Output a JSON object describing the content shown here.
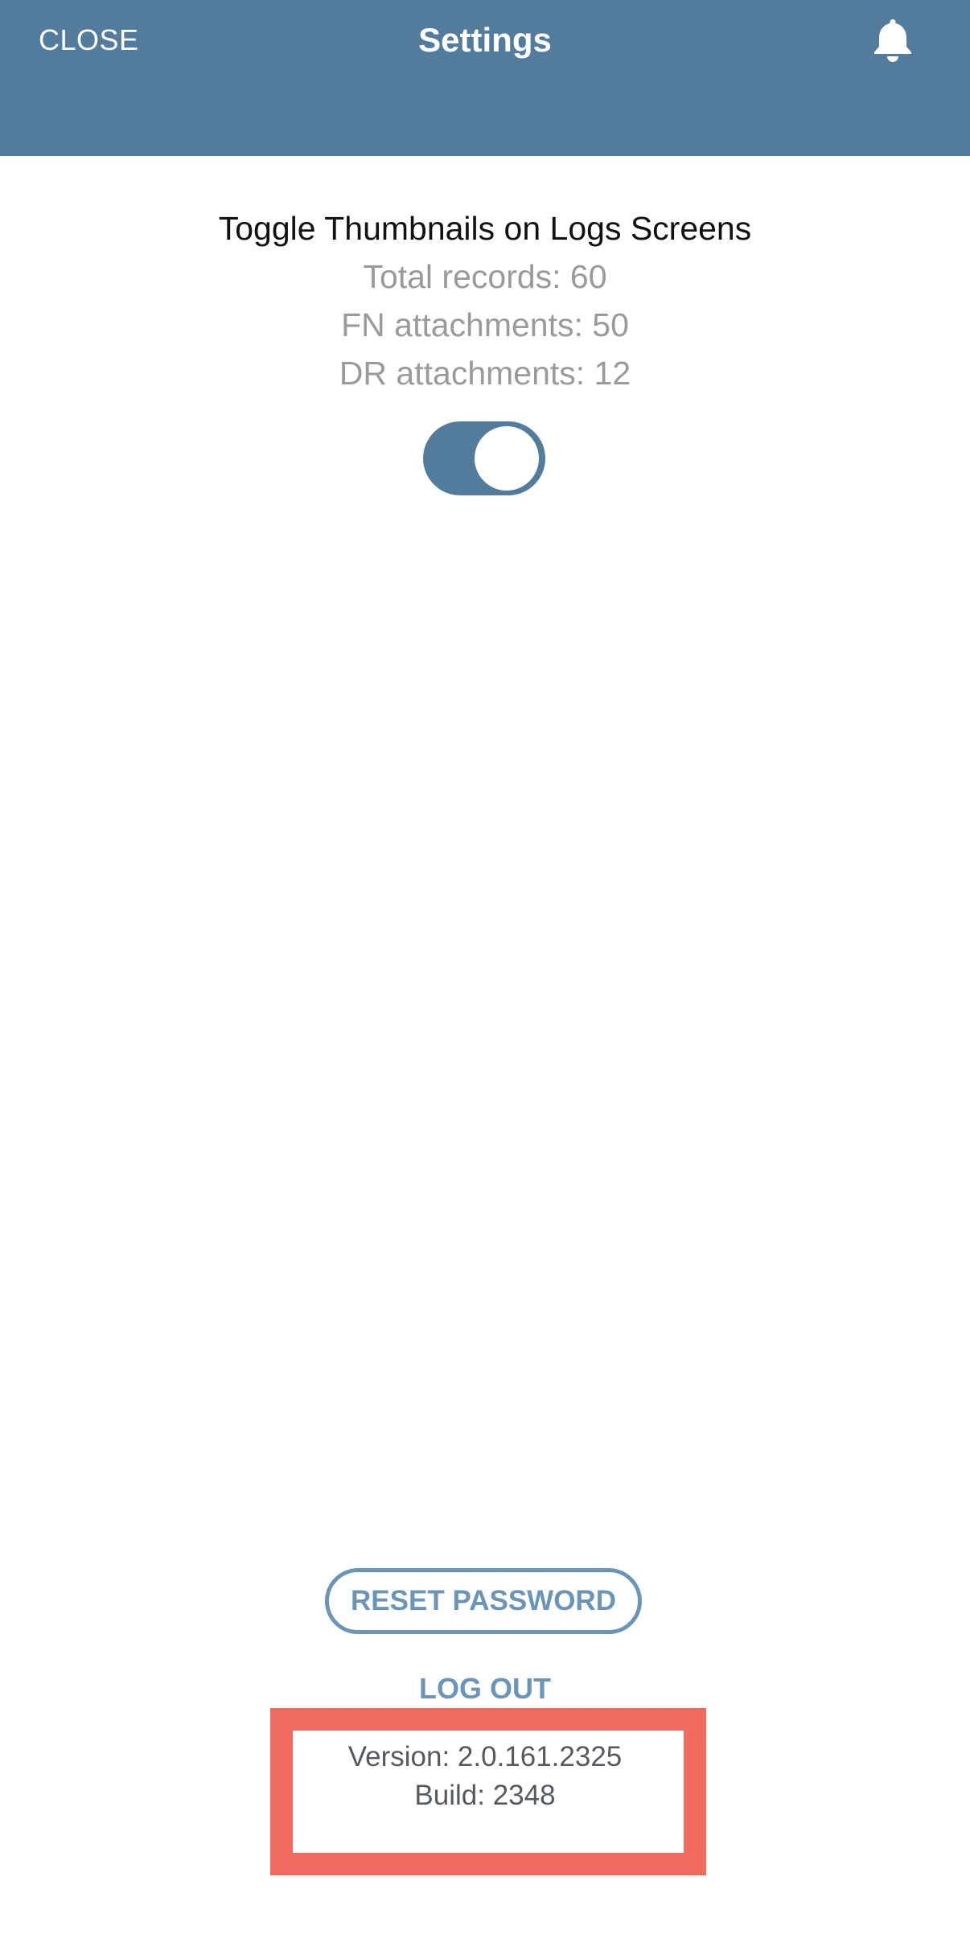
{
  "header": {
    "close_label": "CLOSE",
    "title": "Settings",
    "bell_icon": "bell-icon",
    "background": "#537b9c"
  },
  "thumbnails": {
    "title": "Toggle Thumbnails on Logs Screens",
    "total_records": "Total records: 60",
    "fn_attachments": "FN attachments: 50",
    "dr_attachments": "DR attachments: 12",
    "toggle_on": true
  },
  "actions": {
    "reset_password_label": "RESET PASSWORD",
    "log_out_label": "LOG OUT"
  },
  "app_info": {
    "version": "Version: 2.0.161.2325",
    "build": "Build: 2348"
  },
  "colors": {
    "accent": "#537b9c",
    "link": "#6b95b8",
    "highlight": "#ef6b5e"
  }
}
